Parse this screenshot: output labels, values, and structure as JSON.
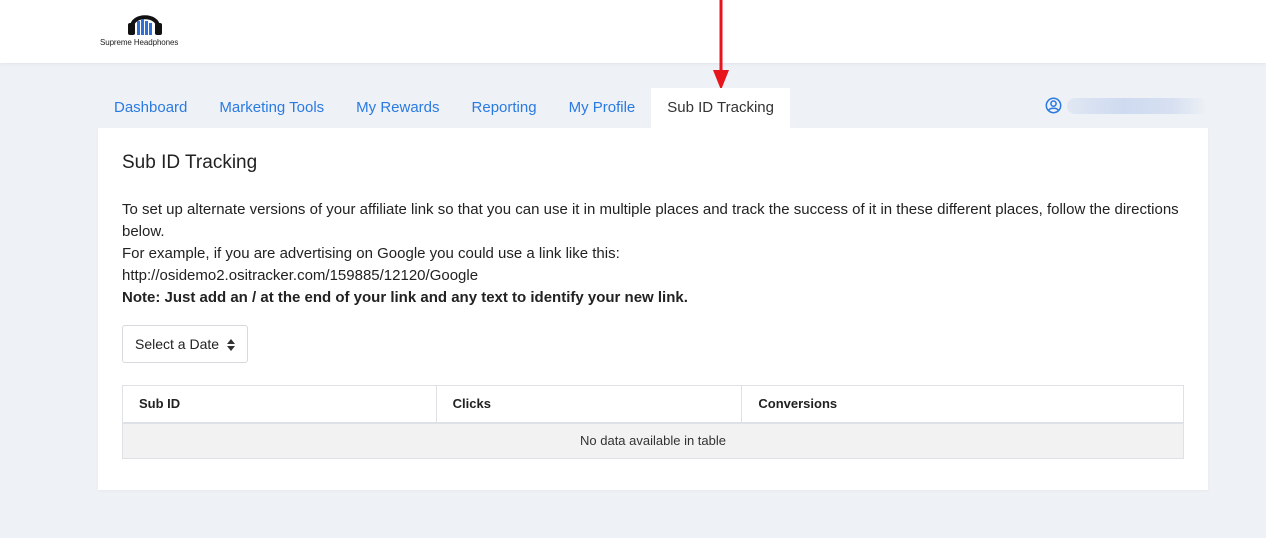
{
  "brand": {
    "name": "Supreme Headphones"
  },
  "nav": {
    "tabs": [
      {
        "label": "Dashboard"
      },
      {
        "label": "Marketing Tools"
      },
      {
        "label": "My Rewards"
      },
      {
        "label": "Reporting"
      },
      {
        "label": "My Profile"
      },
      {
        "label": "Sub ID Tracking",
        "active": true
      }
    ]
  },
  "user": {
    "icon": "user-circle-icon",
    "name": ""
  },
  "main": {
    "title": "Sub ID Tracking",
    "line1": "To set up alternate versions of your affiliate link so that you can use it in multiple places and track the success of it in these different places, follow the directions below.",
    "line2": "For example, if you are advertising on Google you could use a link like this:",
    "line3": "http://osidemo2.ositracker.com/159885/12120/Google",
    "note": "Note: Just add an / at the end of your link and any text to identify your new link."
  },
  "date_select": {
    "label": "Select a Date"
  },
  "table": {
    "columns": [
      "Sub ID",
      "Clicks",
      "Conversions"
    ],
    "empty_message": "No data available in table"
  },
  "colors": {
    "link": "#2a7ae2",
    "background": "#eef1f5",
    "annotation_arrow": "#e8141c"
  }
}
